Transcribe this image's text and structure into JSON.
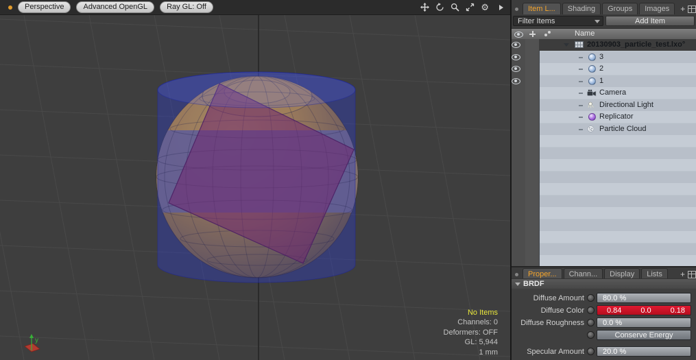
{
  "viewport": {
    "toolbar_buttons": [
      "Perspective",
      "Advanced OpenGL",
      "Ray GL: Off"
    ],
    "axis_gizmo": "y",
    "info": {
      "no_items": "No Items",
      "channels": "Channels: 0",
      "deformers": "Deformers: OFF",
      "gl": "GL: 5,944",
      "grid_size": "1 mm"
    },
    "scene": {
      "objects": [
        "yellow-sphere",
        "red-cube",
        "blue-cylinder"
      ],
      "colors": {
        "sphere": "#d79c16",
        "cube": "#9b1c38",
        "cylinder": "#2c3ccd",
        "background": "#3e3e3e"
      }
    }
  },
  "item_list": {
    "tabs": [
      {
        "label": "Item L...",
        "active": true
      },
      {
        "label": "Shading",
        "active": false
      },
      {
        "label": "Groups",
        "active": false
      },
      {
        "label": "Images",
        "active": false
      }
    ],
    "tab_plus": "+",
    "filter": {
      "label": "Filter Items"
    },
    "add_item": "Add Item",
    "columns": {
      "name": "Name"
    },
    "rows": [
      {
        "label": "20130903_particle_test.lxo°",
        "type": "scene",
        "visible": true
      },
      {
        "label": "3",
        "type": "mesh",
        "visible": true
      },
      {
        "label": "2",
        "type": "mesh",
        "visible": true
      },
      {
        "label": "1",
        "type": "mesh",
        "visible": true
      },
      {
        "label": "Camera",
        "type": "camera",
        "visible": false
      },
      {
        "label": "Directional Light",
        "type": "light",
        "visible": false
      },
      {
        "label": "Replicator",
        "type": "replicator",
        "visible": false
      },
      {
        "label": "Particle Cloud",
        "type": "particle-cloud",
        "visible": false
      }
    ]
  },
  "properties": {
    "tabs": [
      {
        "label": "Proper...",
        "active": true
      },
      {
        "label": "Chann...",
        "active": false
      },
      {
        "label": "Display",
        "active": false
      },
      {
        "label": "Lists",
        "active": false
      }
    ],
    "tab_plus": "+",
    "section_header": "BRDF",
    "fields": {
      "diffuse_amount": {
        "label": "Diffuse Amount",
        "value": "80.0 %"
      },
      "diffuse_color": {
        "label": "Diffuse Color",
        "r": "0.84",
        "g": "0.0",
        "b": "0.18",
        "swatch": "#cf1424"
      },
      "diffuse_roughness": {
        "label": "Diffuse Roughness",
        "value": "0.0 %"
      },
      "conserve_energy": {
        "label": "Conserve Energy"
      },
      "specular_amount": {
        "label": "Specular Amount",
        "value": "20.0 %"
      }
    }
  },
  "colors": {
    "accent_tab": "#f5a52c",
    "list_bg": "#bcc4ce",
    "panel_bg": "#3c3c3c"
  }
}
